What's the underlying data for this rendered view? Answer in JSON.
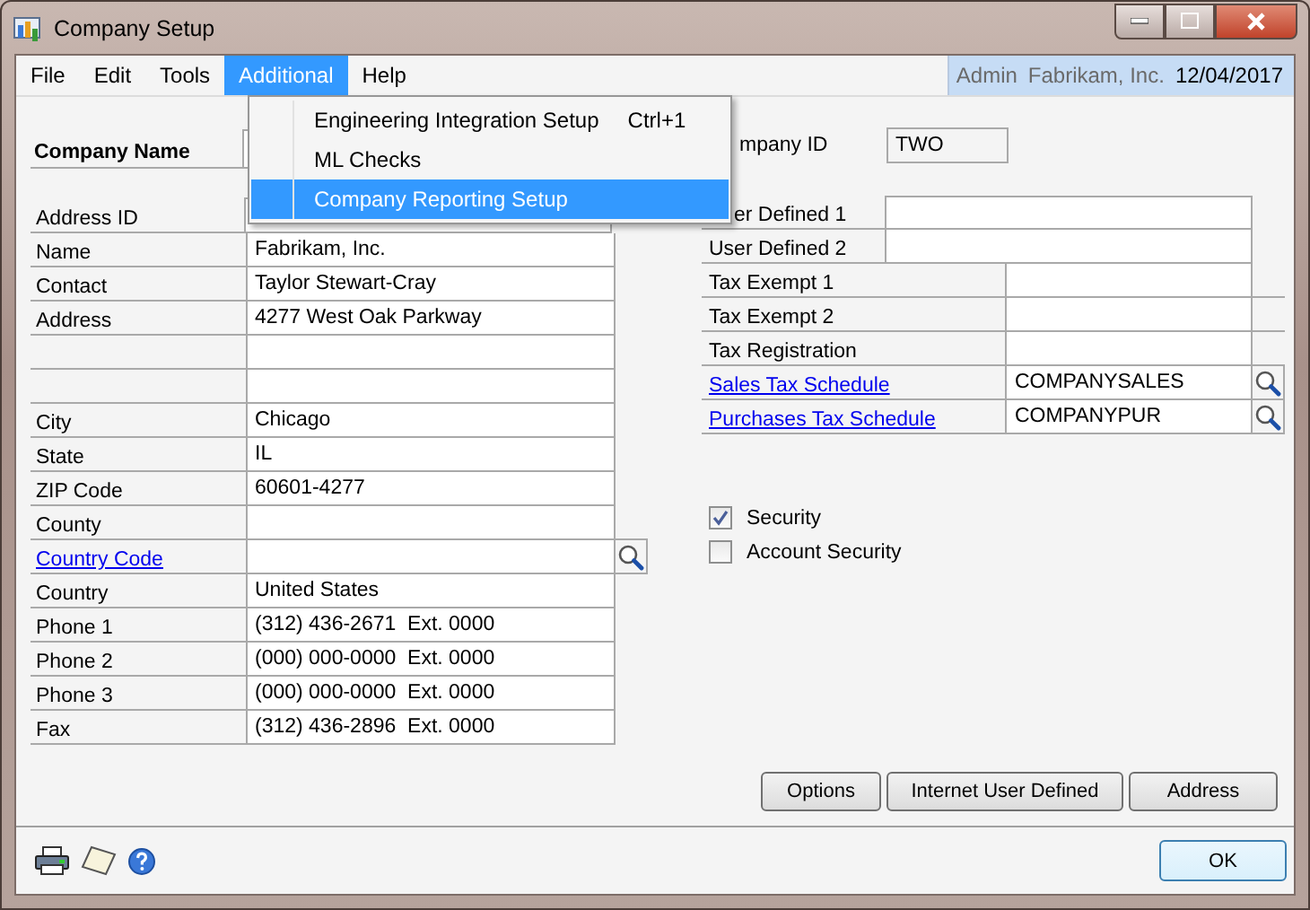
{
  "window": {
    "title": "Company Setup"
  },
  "menu_bar": {
    "items": [
      {
        "label": "File",
        "selected": false
      },
      {
        "label": "Edit",
        "selected": false
      },
      {
        "label": "Tools",
        "selected": false
      },
      {
        "label": "Additional",
        "selected": true
      },
      {
        "label": "Help",
        "selected": false
      }
    ],
    "user": "Admin",
    "company": "Fabrikam, Inc.",
    "date": "12/04/2017"
  },
  "menu": {
    "items": [
      {
        "label": "Engineering Integration Setup",
        "shortcut": "Ctrl+1",
        "selected": false
      },
      {
        "label": "ML Checks",
        "selected": false
      },
      {
        "label": "Company Reporting Setup",
        "selected": true
      }
    ]
  },
  "company_name": {
    "label": "Company Name"
  },
  "address_id": {
    "label": "Address ID"
  },
  "address_fields": [
    {
      "label": "Name",
      "value": "Fabrikam, Inc.",
      "kind": "text"
    },
    {
      "label": "Contact",
      "value": "Taylor Stewart-Cray",
      "kind": "text"
    },
    {
      "label": "Address",
      "value": "4277 West Oak Parkway",
      "kind": "text"
    },
    {
      "kind": "text"
    },
    {
      "kind": "text"
    },
    {
      "label": "City",
      "value": "Chicago",
      "kind": "text"
    },
    {
      "label": "State",
      "value": "IL",
      "kind": "text"
    },
    {
      "label": "ZIP Code",
      "value": "60601-4277",
      "kind": "text"
    },
    {
      "label": "County",
      "kind": "text"
    },
    {
      "label": "Country Code",
      "kind": "link"
    },
    {
      "label": "Country",
      "value": "United States",
      "kind": "text"
    },
    {
      "label": "Phone 1",
      "value": "(312) 436-2671  Ext. 0000",
      "kind": "text"
    },
    {
      "label": "Phone 2",
      "value": "(000) 000-0000  Ext. 0000",
      "kind": "text"
    },
    {
      "label": "Phone 3",
      "value": "(000) 000-0000  Ext. 0000",
      "kind": "text"
    },
    {
      "label": "Fax",
      "value": "(312) 436-2896  Ext. 0000",
      "kind": "text"
    }
  ],
  "company_id": {
    "label": "mpany ID",
    "value": "TWO"
  },
  "user_defined": [
    {
      "label": "er Defined 1"
    },
    {
      "label": "User Defined 2"
    }
  ],
  "tax_fields": [
    {
      "label": "Tax Exempt 1",
      "kind": "text"
    },
    {
      "label": "Tax Exempt 2",
      "kind": "text"
    },
    {
      "label": "Tax Registration",
      "kind": "text"
    },
    {
      "label": "Sales Tax Schedule",
      "value": "COMPANYSALES",
      "kind": "link"
    },
    {
      "label": "Purchases Tax Schedule",
      "value": "COMPANYPUR",
      "kind": "link"
    }
  ],
  "checkboxes": [
    {
      "label": "Security",
      "checked": true
    },
    {
      "label": "Account Security",
      "checked": false
    }
  ],
  "buttons": [
    "Options",
    "Internet User Defined",
    "Address"
  ],
  "ok_button": "OK"
}
